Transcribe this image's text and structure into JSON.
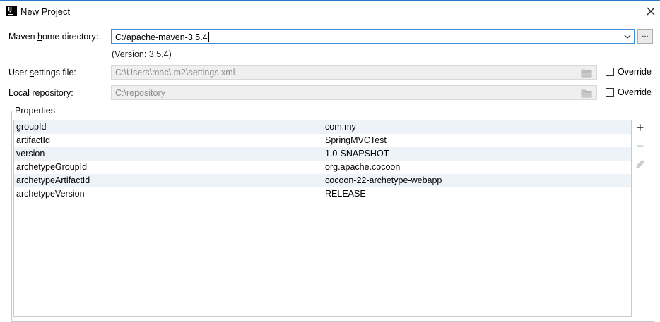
{
  "window": {
    "title": "New Project",
    "icon": "intellij-idea-icon",
    "accent_color": "#2b7bc8"
  },
  "maven": {
    "home_label_pre": "Maven ",
    "home_label_mnemonic": "h",
    "home_label_post": "ome directory:",
    "home_value": "C:/apache-maven-3.5.4",
    "browse_label": "...",
    "version_note": "(Version: 3.5.4)"
  },
  "user_settings": {
    "label_pre": "User ",
    "label_mnemonic": "s",
    "label_post": "ettings file:",
    "value": "C:\\Users\\mac\\.m2\\settings.xml",
    "override_label": "Override",
    "override_checked": false
  },
  "local_repo": {
    "label_pre": "Local ",
    "label_mnemonic": "r",
    "label_post": "epository:",
    "value": "C:\\repository",
    "override_label": "Override",
    "override_checked": false
  },
  "properties": {
    "title": "Properties",
    "rows": [
      {
        "key": "groupId",
        "value": "com.my"
      },
      {
        "key": "artifactId",
        "value": "SpringMVCTest"
      },
      {
        "key": "version",
        "value": "1.0-SNAPSHOT"
      },
      {
        "key": "archetypeGroupId",
        "value": "org.apache.cocoon"
      },
      {
        "key": "archetypeArtifactId",
        "value": "cocoon-22-archetype-webapp"
      },
      {
        "key": "archetypeVersion",
        "value": "RELEASE"
      }
    ],
    "tools": {
      "add": "+",
      "remove": "−"
    }
  }
}
